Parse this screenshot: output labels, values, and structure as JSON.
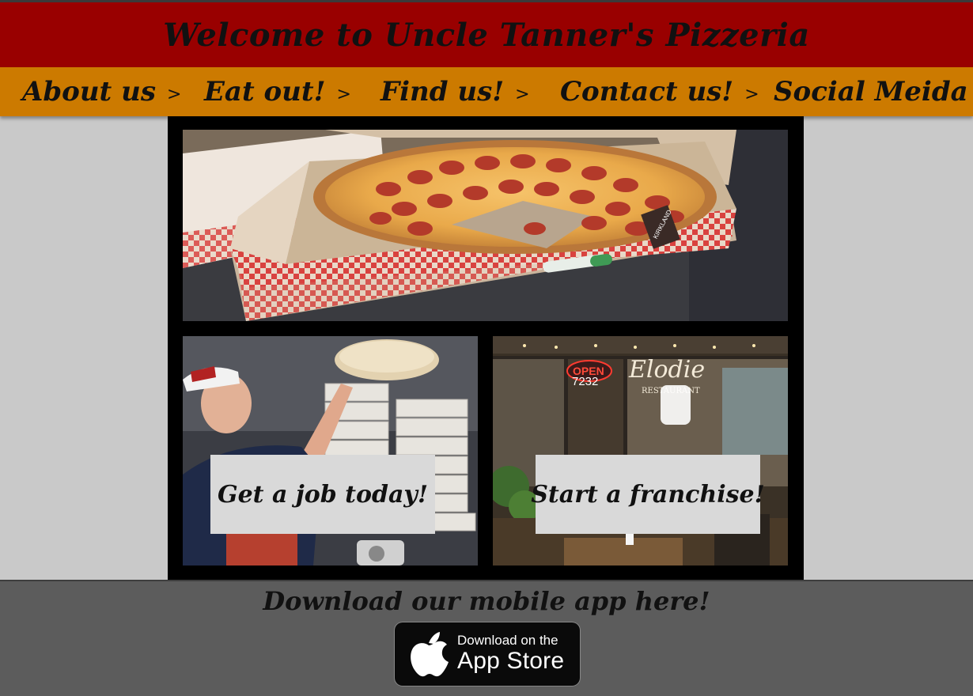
{
  "header": {
    "title": "Welcome to Uncle Tanner's Pizzeria"
  },
  "nav": {
    "items": [
      {
        "label": "About us",
        "arrow": ">"
      },
      {
        "label": "Eat out!",
        "arrow": ">"
      },
      {
        "label": "Find us!",
        "arrow": ">"
      },
      {
        "label": "Contact us!",
        "arrow": ">"
      },
      {
        "label": "Social Meida",
        "arrow": ">"
      }
    ]
  },
  "hero": {
    "image": "pepperoni-pizza-in-boxes-photo",
    "box_brand": "KIRKLAND"
  },
  "tiles": [
    {
      "label": "Get a job today!",
      "image": "pizza-chef-tossing-dough-photo"
    },
    {
      "label": "Start a franchise!",
      "image": "restaurant-storefront-photo",
      "sign_open": "OPEN",
      "street_number": "7232",
      "window_text": "Elodie",
      "window_sub": "RESTAURANT"
    }
  ],
  "footer": {
    "heading": "Download our mobile app here!",
    "app_store": {
      "line1": "Download on the",
      "line2": "App Store"
    }
  },
  "colors": {
    "header_bg": "#990000",
    "nav_bg": "#cc7a00",
    "page_bg": "#c9c9c9",
    "footer_bg": "#5c5c5c"
  }
}
